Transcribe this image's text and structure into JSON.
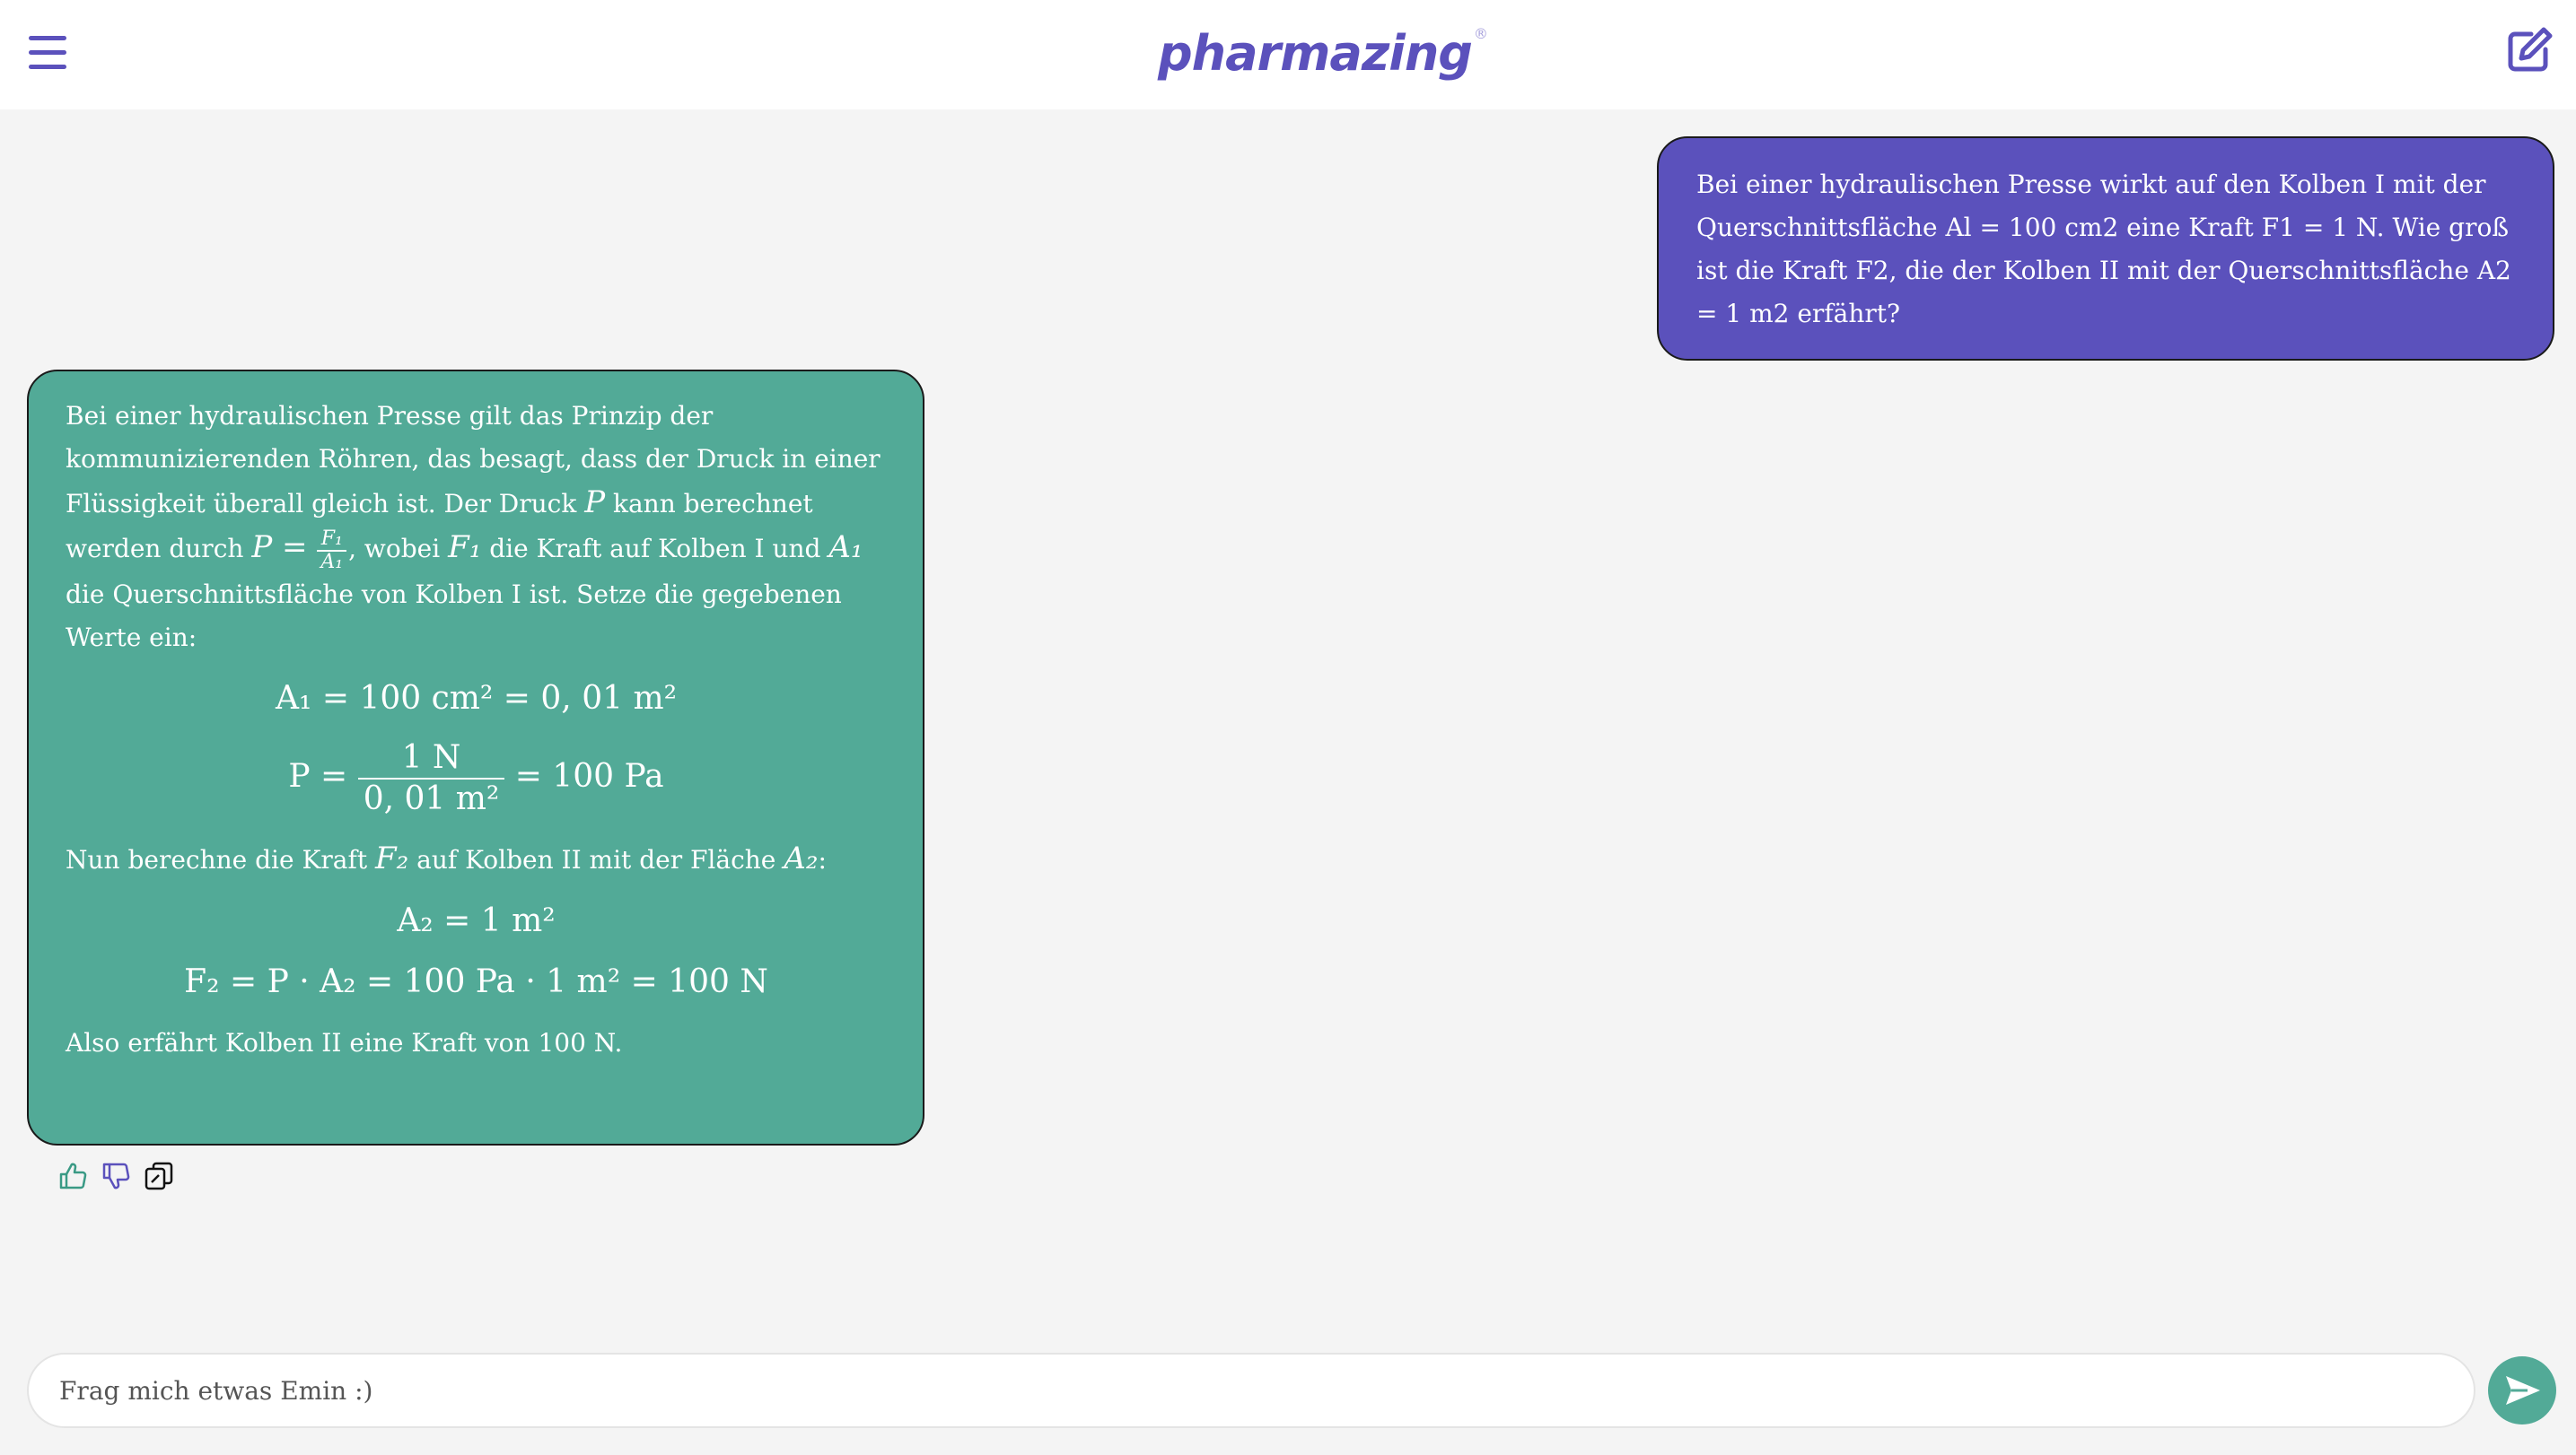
{
  "header": {
    "logo_text": "pharmazing",
    "logo_mark": "®",
    "menu_icon": "hamburger-menu-icon",
    "new_chat_icon": "edit-compose-icon"
  },
  "colors": {
    "brand": "#5b51bc",
    "assistant": "#52aa97",
    "background": "#f4f4f4"
  },
  "user_message": {
    "text": "Bei einer hydraulischen Presse wirkt auf den Kolben I mit der Querschnittsfläche Al = 100 cm2 eine Kraft F1 = 1 N. Wie groß ist die Kraft F2, die der Kolben II mit der Querschnittsfläche A2 = 1 m2 erfährt?"
  },
  "assistant_message": {
    "intro_1": "Bei einer hydraulischen Presse gilt das Prinzip der kommunizierenden Röhren, das besagt, dass der Druck in einer Flüssigkeit überall gleich ist. Der Druck ",
    "var_P": "P",
    "intro_2": " kann berechnet werden durch ",
    "eq_lhs": "P =",
    "frac_num": "F₁",
    "frac_den": "A₁",
    "intro_3": ", wobei ",
    "var_F1": "F₁",
    "intro_4": " die Kraft auf Kolben I und ",
    "var_A1": "A₁",
    "intro_5": " die Querschnittsfläche von Kolben I ist. Setze die gegebenen Werte ein:",
    "eq1": "A₁ = 100 cm² = 0, 01 m²",
    "eq2_lhs": "P =",
    "eq2_num": "1 N",
    "eq2_den": "0, 01 m²",
    "eq2_rhs": "= 100 Pa",
    "mid_1": "Nun berechne die Kraft ",
    "var_F2": "F₂",
    "mid_2": " auf Kolben II mit der Fläche ",
    "var_A2": "A₂",
    "mid_3": ":",
    "eq3": "A₂ = 1 m²",
    "eq4": "F₂ = P · A₂ = 100 Pa · 1 m² = 100 N",
    "conclusion": "Also erfährt Kolben II eine Kraft von 100 N."
  },
  "actions": {
    "like_icon": "thumbs-up-icon",
    "dislike_icon": "thumbs-down-icon",
    "copy_icon": "copy-icon"
  },
  "composer": {
    "placeholder": "Frag mich etwas Emin :)",
    "value": "",
    "send_icon": "send-arrow-icon"
  }
}
